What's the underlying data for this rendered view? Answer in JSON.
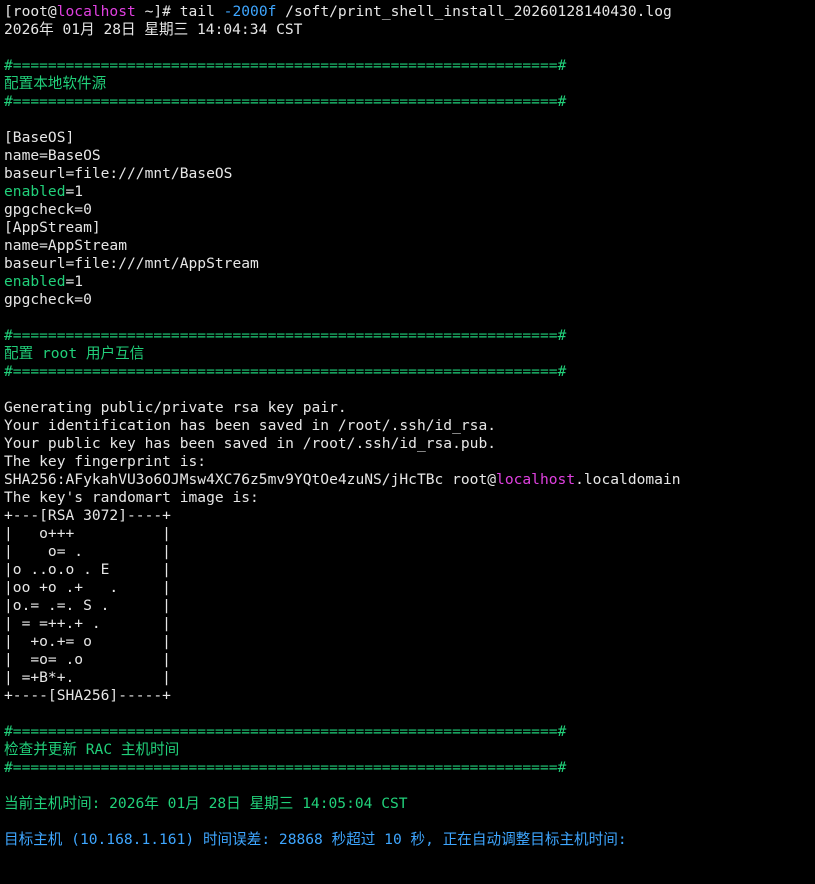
{
  "colors": {
    "background": "#000000",
    "text": "#e6e6e6",
    "green": "#21d07a",
    "blue": "#3ea6ff",
    "magenta": "#e040e0"
  },
  "lines": [
    [
      {
        "t": "[root@",
        "c": "white"
      },
      {
        "t": "localhost",
        "c": "magenta"
      },
      {
        "t": " ~]# tail ",
        "c": "white"
      },
      {
        "t": "-2000f",
        "c": "blue"
      },
      {
        "t": " /soft/print_shell_install_20260128140430.log",
        "c": "white"
      }
    ],
    [
      {
        "t": "2026年 01月 28日 星期三 14:04:34 CST",
        "c": "white"
      }
    ],
    [],
    [
      {
        "t": "#==============================================================#",
        "c": "green"
      }
    ],
    [
      {
        "t": "配置本地软件源",
        "c": "green"
      }
    ],
    [
      {
        "t": "#==============================================================#",
        "c": "green"
      }
    ],
    [],
    [
      {
        "t": "[BaseOS]",
        "c": "white"
      }
    ],
    [
      {
        "t": "name=BaseOS",
        "c": "white"
      }
    ],
    [
      {
        "t": "baseurl=file:///mnt/BaseOS",
        "c": "white"
      }
    ],
    [
      {
        "t": "enabled",
        "c": "green"
      },
      {
        "t": "=1",
        "c": "white"
      }
    ],
    [
      {
        "t": "gpgcheck=0",
        "c": "white"
      }
    ],
    [
      {
        "t": "[AppStream]",
        "c": "white"
      }
    ],
    [
      {
        "t": "name=AppStream",
        "c": "white"
      }
    ],
    [
      {
        "t": "baseurl=file:///mnt/AppStream",
        "c": "white"
      }
    ],
    [
      {
        "t": "enabled",
        "c": "green"
      },
      {
        "t": "=1",
        "c": "white"
      }
    ],
    [
      {
        "t": "gpgcheck=0",
        "c": "white"
      }
    ],
    [],
    [
      {
        "t": "#==============================================================#",
        "c": "green"
      }
    ],
    [
      {
        "t": "配置 root 用户互信",
        "c": "green"
      }
    ],
    [
      {
        "t": "#==============================================================#",
        "c": "green"
      }
    ],
    [],
    [
      {
        "t": "Generating public/private rsa key pair.",
        "c": "white"
      }
    ],
    [
      {
        "t": "Your identification has been saved in /root/.ssh/id_rsa.",
        "c": "white"
      }
    ],
    [
      {
        "t": "Your public key has been saved in /root/.ssh/id_rsa.pub.",
        "c": "white"
      }
    ],
    [
      {
        "t": "The key fingerprint is:",
        "c": "white"
      }
    ],
    [
      {
        "t": "SHA256:AFykahVU3o6OJMsw4XC76z5mv9YQtOe4zuNS/jHcTBc root@",
        "c": "white"
      },
      {
        "t": "localhost",
        "c": "magenta"
      },
      {
        "t": ".localdomain",
        "c": "white"
      }
    ],
    [
      {
        "t": "The key's randomart image is:",
        "c": "white"
      }
    ],
    [
      {
        "t": "+---[RSA 3072]----+",
        "c": "white"
      }
    ],
    [
      {
        "t": "|   o+++          |",
        "c": "white"
      }
    ],
    [
      {
        "t": "|    o= .         |",
        "c": "white"
      }
    ],
    [
      {
        "t": "|o ..o.o . E      |",
        "c": "white"
      }
    ],
    [
      {
        "t": "|oo +o .+   .     |",
        "c": "white"
      }
    ],
    [
      {
        "t": "|o.= .=. S .      |",
        "c": "white"
      }
    ],
    [
      {
        "t": "| = =++.+ .       |",
        "c": "white"
      }
    ],
    [
      {
        "t": "|  +o.+= o        |",
        "c": "white"
      }
    ],
    [
      {
        "t": "|  =o= .o         |",
        "c": "white"
      }
    ],
    [
      {
        "t": "| =+B*+.          |",
        "c": "white"
      }
    ],
    [
      {
        "t": "+----[SHA256]-----+",
        "c": "white"
      }
    ],
    [],
    [
      {
        "t": "#==============================================================#",
        "c": "green"
      }
    ],
    [
      {
        "t": "检查并更新 RAC 主机时间",
        "c": "green"
      }
    ],
    [
      {
        "t": "#==============================================================#",
        "c": "green"
      }
    ],
    [],
    [
      {
        "t": "当前主机时间: 2026年 01月 28日 星期三 14:05:04 CST",
        "c": "green"
      }
    ],
    [],
    [
      {
        "t": "目标主机 (10.168.1.161) 时间误差: 28868 秒超过 10 秒, 正在自动调整目标主机时间:",
        "c": "blue"
      }
    ]
  ]
}
